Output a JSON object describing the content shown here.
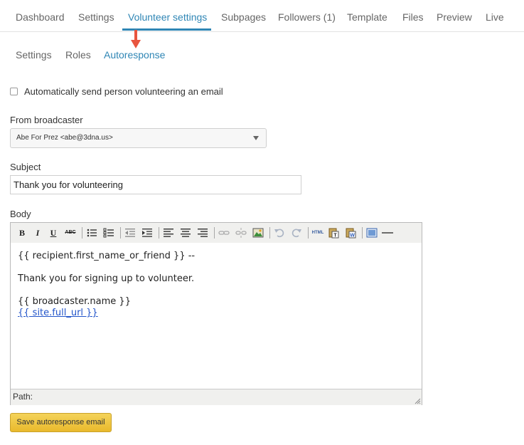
{
  "tabs": [
    {
      "label": "Dashboard"
    },
    {
      "label": "Settings"
    },
    {
      "label": "Volunteer settings"
    },
    {
      "label": "Subpages"
    },
    {
      "label": "Followers (1)"
    },
    {
      "label": "Template"
    },
    {
      "label": "Files"
    },
    {
      "label": "Preview"
    },
    {
      "label": "Live"
    }
  ],
  "active_tab": "Volunteer settings",
  "subtabs": [
    {
      "label": "Settings"
    },
    {
      "label": "Roles"
    },
    {
      "label": "Autoresponse"
    }
  ],
  "active_subtab": "Autoresponse",
  "form": {
    "auto_send": {
      "label": "Automatically send person volunteering an email",
      "checked": false
    },
    "from": {
      "label": "From broadcaster",
      "value": "Abe For Prez <abe@3dna.us>"
    },
    "subject": {
      "label": "Subject",
      "value": "Thank you for volunteering"
    },
    "body": {
      "label": "Body",
      "lines": [
        "{{ recipient.first_name_or_friend }} --",
        "Thank you for signing up to volunteer.",
        "{{ broadcaster.name }}",
        "{{ site.full_url }}"
      ],
      "path_label": "Path:"
    },
    "save_label": "Save autoresponse email"
  },
  "toolbar": {
    "bold": "B",
    "italic": "I",
    "underline": "U",
    "strike": "ABC",
    "html": "HTML"
  },
  "colors": {
    "accent": "#2f86b5",
    "arrow": "#e8553f",
    "save_button": "#f0c640",
    "link": "#2254c9"
  },
  "icons": [
    "arrow-down-icon",
    "bullet-list-icon",
    "numbered-list-icon",
    "outdent-icon",
    "indent-icon",
    "align-left-icon",
    "align-center-icon",
    "align-right-icon",
    "link-icon",
    "unlink-icon",
    "image-icon",
    "undo-icon",
    "redo-icon",
    "paste-text-icon",
    "paste-word-icon",
    "fullscreen-icon",
    "horizontal-rule-icon",
    "resize-handle-icon"
  ]
}
